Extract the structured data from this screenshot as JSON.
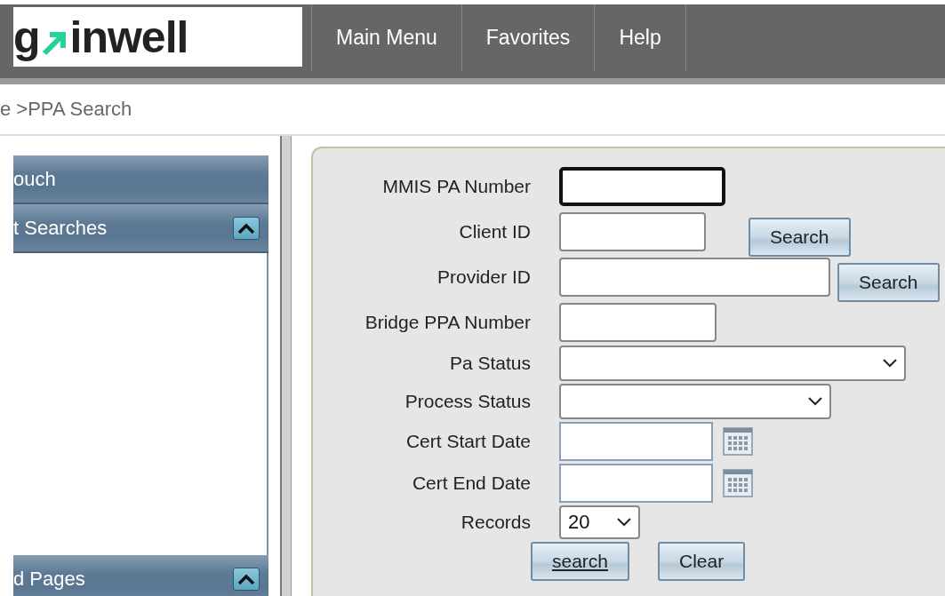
{
  "logo": {
    "parts": [
      "g",
      "inwell"
    ]
  },
  "nav": [
    {
      "label": "Main Menu"
    },
    {
      "label": "Favorites"
    },
    {
      "label": "Help"
    }
  ],
  "breadcrumb": "e >PPA Search",
  "sidebar": {
    "panels": [
      {
        "title": "ouch",
        "kind": "bar"
      },
      {
        "title": "t Searches",
        "kind": "toggle",
        "expanded": true
      },
      {
        "title": "d Pages",
        "kind": "toggle",
        "expanded": true
      }
    ]
  },
  "form": {
    "fields": [
      {
        "label": "MMIS PA Number",
        "kind": "text",
        "focused": true
      },
      {
        "label": "Client ID",
        "kind": "text",
        "focused": false,
        "button": "Search"
      },
      {
        "label": "Provider ID",
        "kind": "text",
        "focused": false,
        "button": "Search"
      },
      {
        "label": "Bridge PPA Number",
        "kind": "text",
        "focused": false
      },
      {
        "label": "Pa Status",
        "kind": "select",
        "focused": false
      },
      {
        "label": "Process Status",
        "kind": "select",
        "focused": false
      },
      {
        "label": "Cert Start Date",
        "kind": "date",
        "focused": false
      },
      {
        "label": "Cert End Date",
        "kind": "date",
        "focused": false
      },
      {
        "label": "Records",
        "kind": "select",
        "focused": false,
        "value": "20"
      }
    ],
    "actions": [
      {
        "label": "search",
        "underlined": true
      },
      {
        "label": "Clear",
        "underlined": false
      }
    ]
  }
}
